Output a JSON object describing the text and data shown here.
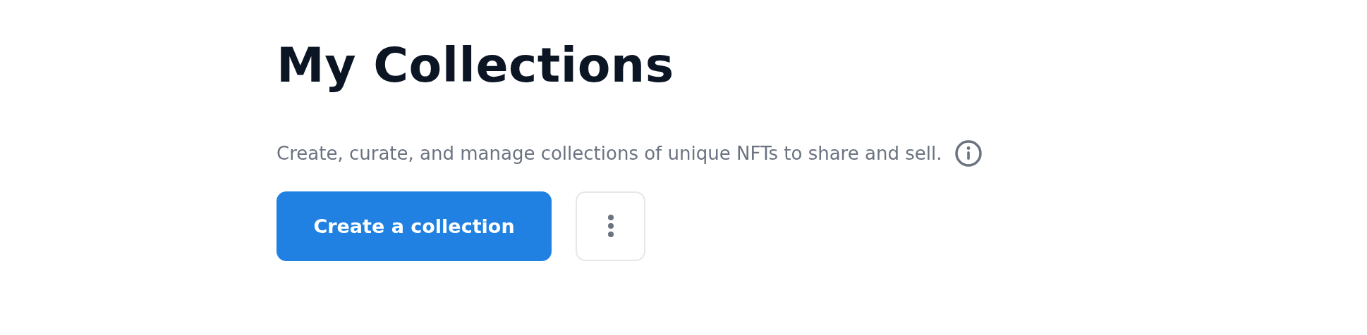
{
  "title": "My Collections",
  "description": "Create, curate, and manage collections of unique NFTs to share and sell.",
  "primary_button": "Create a collection"
}
